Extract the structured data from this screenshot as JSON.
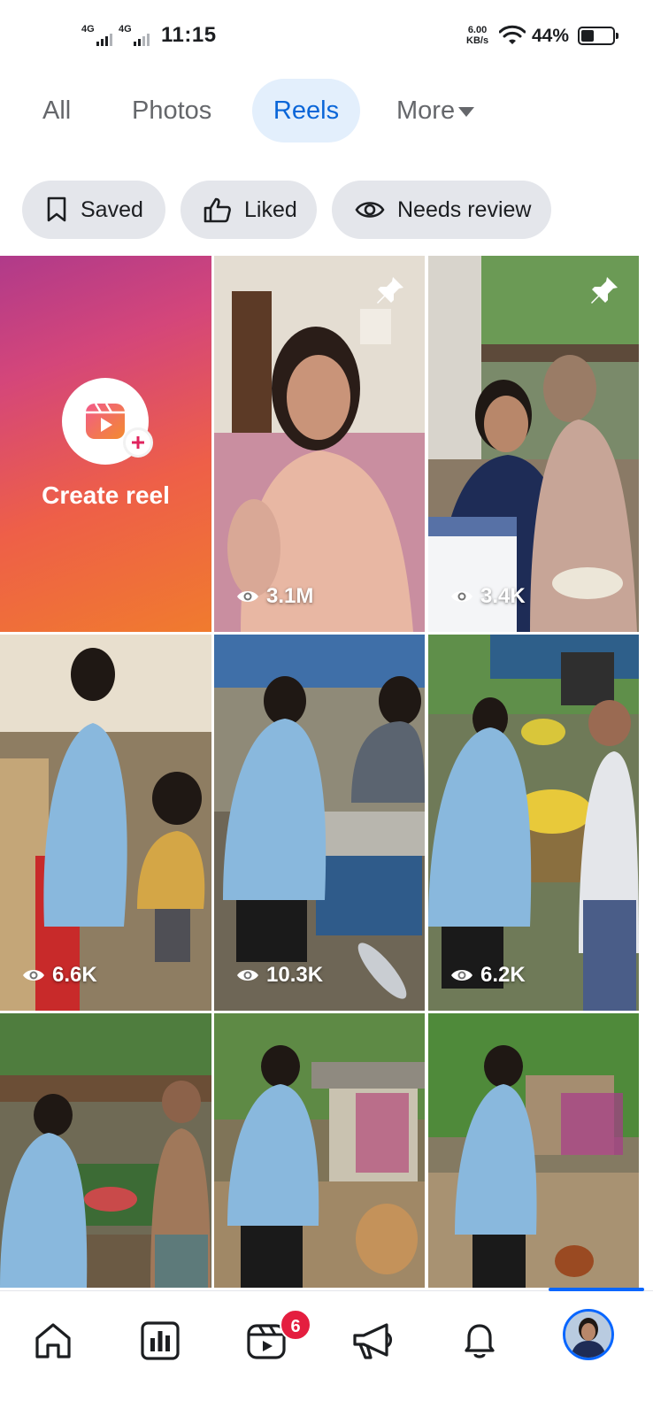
{
  "status_bar": {
    "sim1": "4G",
    "sim2": "4G",
    "time": "11:15",
    "speed_value": "6.00",
    "speed_unit": "KB/s",
    "battery": "44%",
    "battery_level": 0.44
  },
  "tabs": [
    {
      "label": "All",
      "active": false
    },
    {
      "label": "Photos",
      "active": false
    },
    {
      "label": "Reels",
      "active": true
    },
    {
      "label": "More",
      "active": false
    }
  ],
  "chips": [
    {
      "label": "Saved",
      "icon": "bookmark-icon"
    },
    {
      "label": "Liked",
      "icon": "thumbs-up-icon"
    },
    {
      "label": "Needs review",
      "icon": "eye-icon"
    }
  ],
  "create_reel": {
    "label": "Create reel",
    "icon": "reels-icon"
  },
  "reels": [
    {
      "views": "3.1M",
      "pinned": true
    },
    {
      "views": "3.4K",
      "pinned": true
    },
    {
      "views": "6.6K",
      "pinned": false
    },
    {
      "views": "10.3K",
      "pinned": false
    },
    {
      "views": "6.2K",
      "pinned": false
    },
    {
      "views": "",
      "pinned": false
    },
    {
      "views": "",
      "pinned": false
    },
    {
      "views": "",
      "pinned": false
    }
  ],
  "bottom_nav": {
    "items": [
      "home-icon",
      "dashboard-icon",
      "reels-icon",
      "megaphone-icon",
      "bell-icon",
      "profile-avatar"
    ],
    "reels_badge": "6",
    "active": "profile-avatar"
  },
  "colors": {
    "accent": "#0866ff",
    "active_tab_bg": "#e3effc",
    "chip_bg": "#e4e6eb",
    "badge": "#e41e3f"
  }
}
